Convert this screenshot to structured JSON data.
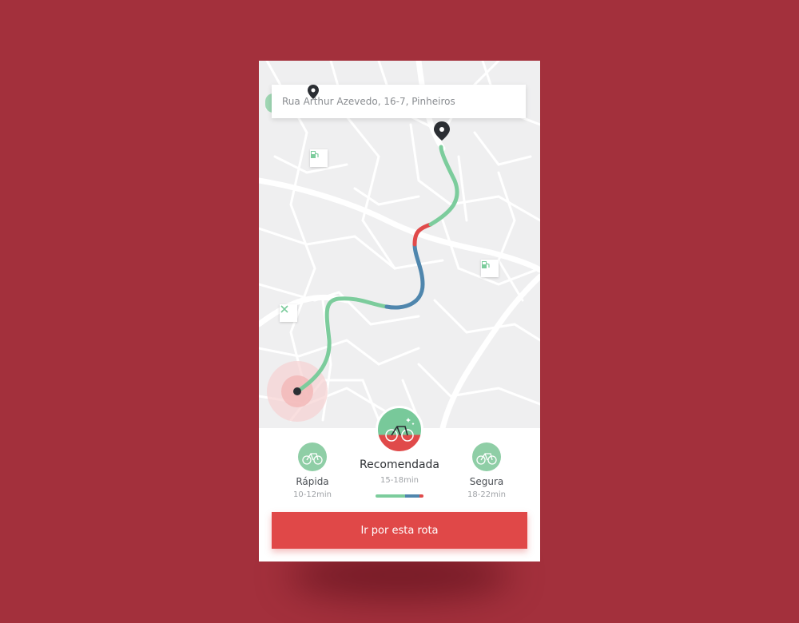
{
  "search": {
    "address": "Rua Arthur Azevedo, 16-7, Pinheiros",
    "icon": "location-pin-icon"
  },
  "map": {
    "route_colors": {
      "fast": "#7ccc9c",
      "busy": "#e04a4a",
      "calm": "#4f86ad"
    },
    "pois": [
      {
        "icon": "gas-station-icon"
      },
      {
        "icon": "gas-station-icon"
      },
      {
        "icon": "bike-repair-icon"
      }
    ]
  },
  "route_options": {
    "fast": {
      "label": "Rápida",
      "time": "10-12min",
      "icon": "bicycle-icon"
    },
    "recommended": {
      "label": "Recomendada",
      "time": "15-18min",
      "icon": "bicycle-sparkle-icon",
      "mix": {
        "green": 0.62,
        "blue": 0.3,
        "red": 0.08
      }
    },
    "safe": {
      "label": "Segura",
      "time": "18-22min",
      "icon": "bicycle-icon"
    }
  },
  "action": {
    "label": "Ir por esta rota"
  },
  "colors": {
    "background": "#a3303c",
    "accent": "#e04848",
    "green": "#78c99a",
    "blue": "#4f86ad"
  }
}
